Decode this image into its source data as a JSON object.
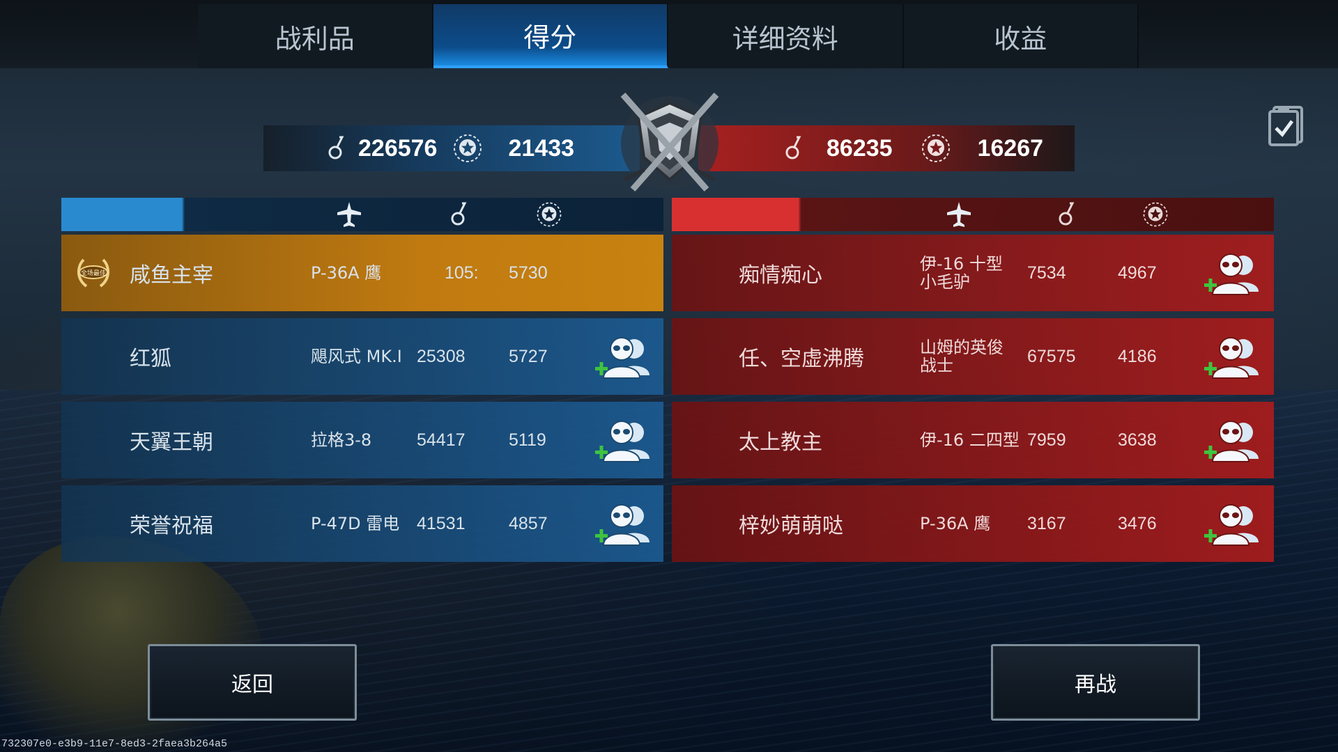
{
  "tabs": [
    {
      "label": "战利品",
      "active": false
    },
    {
      "label": "得分",
      "active": true
    },
    {
      "label": "详细资料",
      "active": false
    },
    {
      "label": "收益",
      "active": false
    }
  ],
  "summary": {
    "blue": {
      "score": "226576",
      "points": "21433"
    },
    "red": {
      "score": "86235",
      "points": "16267"
    }
  },
  "icons": {
    "header": [
      "plane-icon",
      "score-medal-icon",
      "star-laurel-icon"
    ],
    "friend": "add-friend-icon",
    "mvp": "laurel-badge-icon",
    "clipboard": "clipboard-check-icon"
  },
  "mvp_badge_text": "全场最佳",
  "blue_team": [
    {
      "name": "咸鱼主宰",
      "plane": "P-36A 鹰",
      "score": "105:",
      "points": "5730",
      "mvp": true,
      "add_friend": false
    },
    {
      "name": "红狐",
      "plane": "飓风式 MK.I",
      "score": "25308",
      "points": "5727",
      "mvp": false,
      "add_friend": true
    },
    {
      "name": "天翼王朝",
      "plane": "拉格3-8",
      "score": "54417",
      "points": "5119",
      "mvp": false,
      "add_friend": true
    },
    {
      "name": "荣誉祝福",
      "plane": "P-47D 雷电",
      "score": "41531",
      "points": "4857",
      "mvp": false,
      "add_friend": true
    }
  ],
  "red_team": [
    {
      "name": "痴情痴心",
      "plane_line1": "伊-16 十型",
      "plane_line2": "小毛驴",
      "score": "7534",
      "points": "4967",
      "add_friend": true
    },
    {
      "name": "任、空虚沸腾",
      "plane_line1": "山姆的英俊",
      "plane_line2": "战士",
      "score": "67575",
      "points": "4186",
      "add_friend": true
    },
    {
      "name": "太上教主",
      "plane_line1": "伊-16 二四型",
      "plane_line2": "",
      "score": "7959",
      "points": "3638",
      "add_friend": true
    },
    {
      "name": "梓妙萌萌哒",
      "plane_line1": "P-36A 鹰",
      "plane_line2": "",
      "score": "3167",
      "points": "3476",
      "add_friend": true
    }
  ],
  "buttons": {
    "back": "返回",
    "rematch": "再战"
  },
  "match_id": "732307e0-e3b9-11e7-8ed3-2faea3b264a5",
  "colors": {
    "blue_team": "#2a8ad0",
    "red_team": "#d83030",
    "mvp_row": "#c07a10",
    "add_friend_plus": "#3ec43e"
  }
}
